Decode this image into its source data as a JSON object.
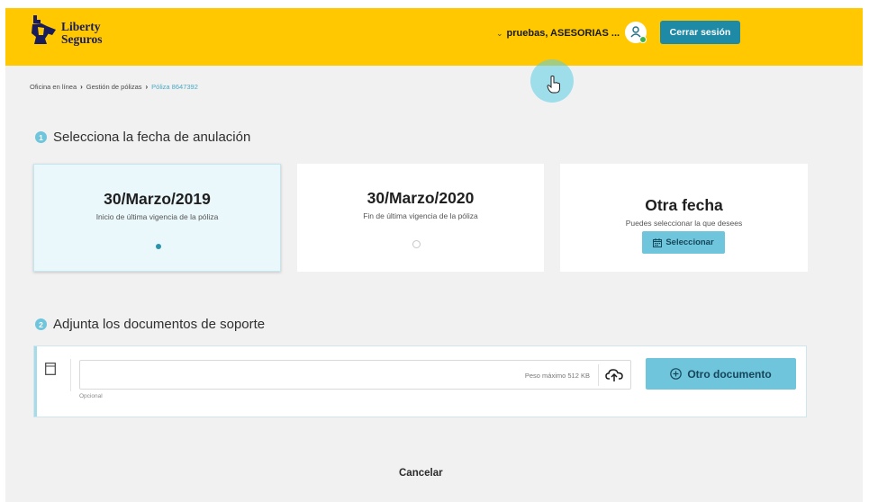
{
  "brand": {
    "line1": "Liberty",
    "line2": "Seguros"
  },
  "header": {
    "user_label": "pruebas, ASESORIAS ...",
    "logout_label": "Cerrar sesión"
  },
  "breadcrumb": {
    "items": [
      "Oficina en línea",
      "Gestión de pólizas"
    ],
    "current": "Póliza 8647392"
  },
  "step1": {
    "number": "1",
    "title": "Selecciona la fecha de anulación",
    "cards": [
      {
        "date": "30/Marzo/2019",
        "description": "Inicio de última vigencia de la póliza",
        "selected": true
      },
      {
        "date": "30/Marzo/2020",
        "description": "Fin de última vigencia de la póliza",
        "selected": false
      }
    ],
    "other": {
      "title": "Otra fecha",
      "description": "Puedes seleccionar la que desees",
      "button_label": "Seleccionar"
    }
  },
  "step2": {
    "number": "2",
    "title": "Adjunta los documentos de soporte",
    "file_hint": "Peso máximo 512 KB",
    "optional_label": "Opcional",
    "other_doc_label": "Otro documento"
  },
  "footer": {
    "cancel_label": "Cancelar"
  },
  "colors": {
    "header_bg": "#ffc800",
    "accent": "#1f8aa5",
    "light_accent": "#6fc5dc",
    "brand_navy": "#1a1d5c"
  },
  "icons": {
    "logo": "liberty-statue-logo",
    "user": "user-icon",
    "calendar": "calendar-icon",
    "document": "document-icon",
    "upload": "cloud-upload-icon",
    "add": "plus-circle-icon",
    "cursor": "hand-pointer-icon"
  }
}
